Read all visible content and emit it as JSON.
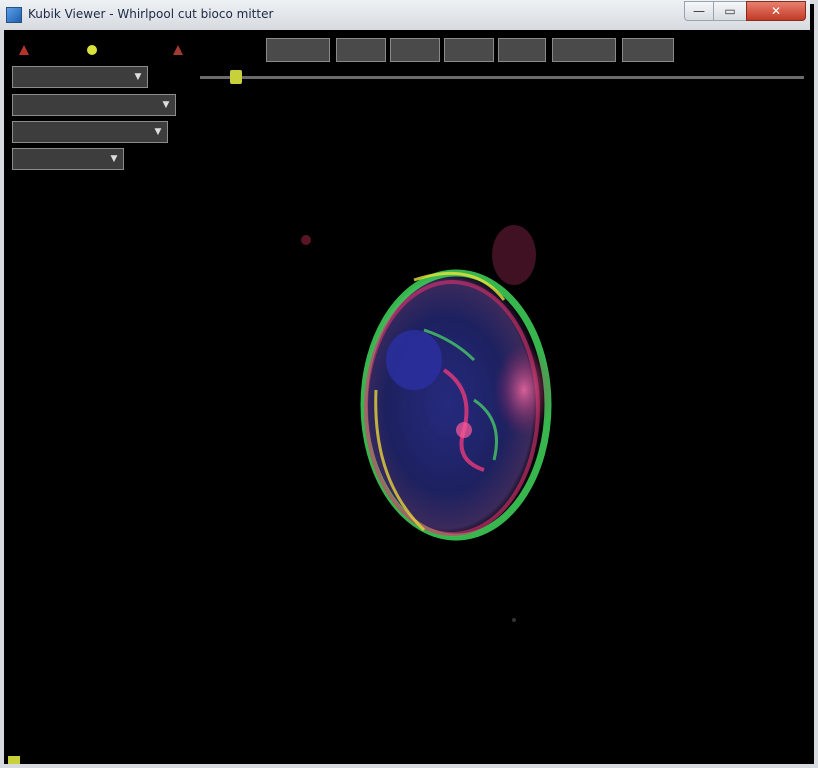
{
  "window": {
    "title": "Kubik Viewer - Whirlpool cut bioco mitter"
  },
  "title_buttons": {
    "minimize": "—",
    "maximize": "▭",
    "close": "✕"
  },
  "toolbar": {
    "buttons": [
      "",
      "",
      "",
      "",
      "",
      "",
      ""
    ],
    "right_text": ""
  },
  "dropdowns": [
    {
      "value": ""
    },
    {
      "value": ""
    },
    {
      "value": ""
    },
    {
      "value": ""
    }
  ],
  "slider": {
    "value": 0.05
  },
  "status": {
    "text": ""
  },
  "colors": {
    "background": "#000000",
    "accent_yellow": "#c9d13a",
    "nebula_green": "#3fd65a",
    "nebula_pink": "#e0306e",
    "nebula_blue": "#2b2f8e"
  },
  "icons": [
    "app-icon",
    "red-tool-icon",
    "yellow-tool-icon",
    "red-tool-icon-2",
    "dropdown-arrow-icon"
  ]
}
